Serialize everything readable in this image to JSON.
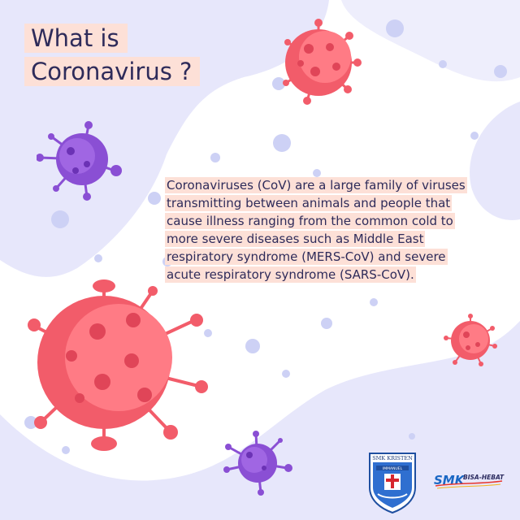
{
  "title": {
    "line1": "What is",
    "line2": "Coronavirus ?"
  },
  "body": {
    "lines": [
      "Coronaviruses (CoV) are a large family of viruses",
      "transmitting between animals and people that",
      "cause illness ranging from the common cold to",
      "more severe diseases such as Middle East",
      "respiratory syndrome (MERS-CoV) and severe",
      "acute respiratory syndrome (SARS-CoV)."
    ]
  },
  "logos": {
    "school_name": "SMK KRISTEN",
    "school_sub": "IMMANUEL",
    "brand": "SMK",
    "brand_tag": "BISA-HEBAT"
  },
  "colors": {
    "background_blob": "#e7e7fb",
    "dots": "#cdd1f5",
    "virus_red": "#f25c6a",
    "virus_red_light": "#ff8a92",
    "virus_purple": "#8a4fd4",
    "text_highlight": "#fde0d7",
    "text": "#2e2b5a"
  },
  "icons": [
    "virus-icon",
    "school-logo-icon",
    "smk-logo-icon"
  ]
}
